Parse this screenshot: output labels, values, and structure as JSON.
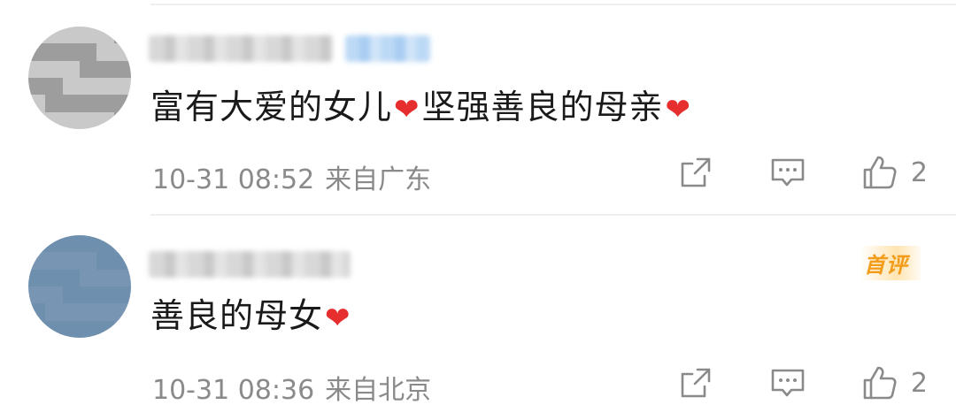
{
  "comments": [
    {
      "text_part1": "富有大爱的女儿",
      "heart1": "❤",
      "text_part2": "坚强善良的母亲",
      "heart2": "❤",
      "time": "10-31 08:52",
      "region": "来自广东",
      "likes": "2",
      "badge": ""
    },
    {
      "text_part1": "善良的母女",
      "heart1": "❤",
      "time": "10-31 08:36",
      "region": "来自北京",
      "likes": "2",
      "badge": "首评"
    }
  ],
  "colors": {
    "text_primary": "#1a1a1a",
    "text_secondary": "#8a8a8a",
    "heart": "#e62e2e",
    "badge": "#f39c1a",
    "username_blue": "#bcd9f5"
  },
  "icons": {
    "share": "share-icon",
    "comment": "comment-icon",
    "like": "thumbs-up-icon",
    "heart": "heart-emoji"
  }
}
